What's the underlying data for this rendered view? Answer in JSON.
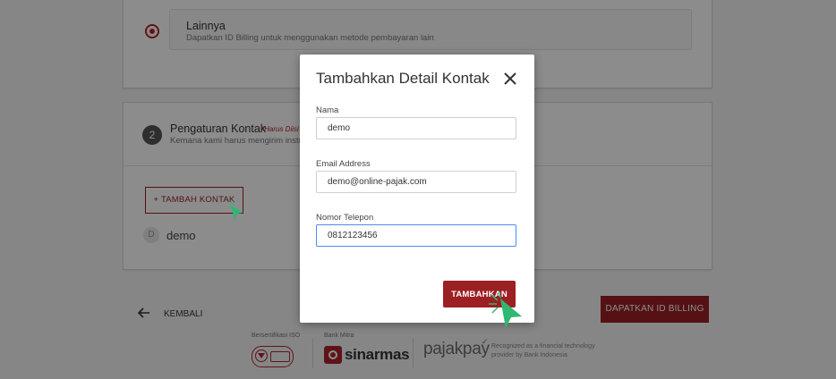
{
  "payment_option": {
    "title": "Lainnya",
    "description": "Dapatkan ID Billing untuk menggunakan metode pembayaran lain"
  },
  "contact_section": {
    "step": "2",
    "title": "Pengaturan Kontak",
    "required_note": "*Harus Diisi",
    "description": "Kemana kami harus mengirim instruksi",
    "add_contact_label": "+ TAMBAH KONTAK",
    "contact_avatar": "D",
    "contact_name": "demo"
  },
  "footer_nav": {
    "back_label": "KEMBALI",
    "get_billing_label": "DAPATKAN ID BILLING"
  },
  "footer_logos": {
    "iso_label": "Bersertifikasi ISO",
    "bank_label": "Bank Mitra",
    "bank_name": "sinarmas",
    "pajakpay_name": "pajakpay",
    "pajakpay_desc": "Recognized as a financial technology provider by Bank Indonesia"
  },
  "modal": {
    "title": "Tambahkan Detail Kontak",
    "name_label": "Nama",
    "name_value": "demo",
    "email_label": "Email Address",
    "email_value": "demo@online-pajak.com",
    "phone_label": "Nomor Telepon",
    "phone_value": "0812123456",
    "submit_label": "TAMBAHKAN"
  },
  "colors": {
    "brand_red": "#9c1f24",
    "focus_blue": "#4b8bf5",
    "cursor_green": "#2eb872"
  },
  "icons": [
    "radio-selected-icon",
    "close-icon",
    "arrow-left-icon",
    "iso-badge-icon",
    "sinarmas-logo-icon",
    "cursor-icon"
  ]
}
